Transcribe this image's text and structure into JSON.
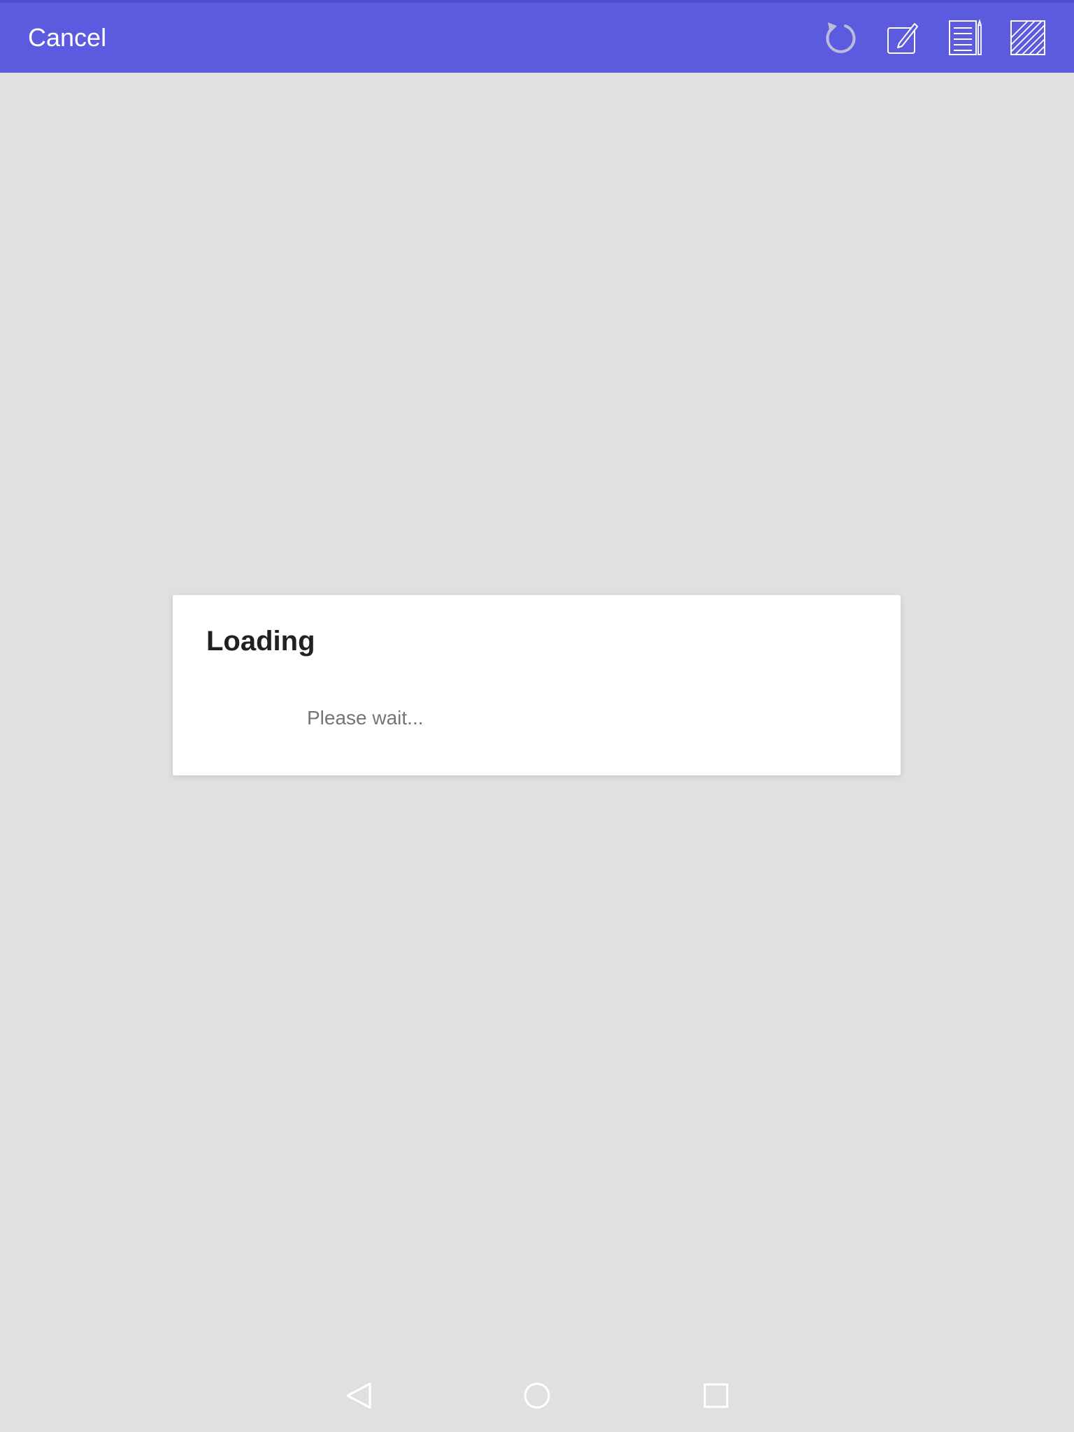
{
  "toolbar": {
    "cancel_label": "Cancel",
    "background_color": "#5c5bdf",
    "icons": [
      "refresh-icon",
      "edit-icon",
      "document-pen-icon",
      "hatch-pattern-icon"
    ]
  },
  "dialog": {
    "title": "Loading",
    "message": "Please wait..."
  },
  "navigation": {
    "icons": [
      "back-icon",
      "home-icon",
      "recent-apps-icon"
    ]
  },
  "colors": {
    "screen_background": "#e0e0e0",
    "dialog_background": "#ffffff",
    "title_text": "#212121",
    "message_text": "#757575"
  }
}
